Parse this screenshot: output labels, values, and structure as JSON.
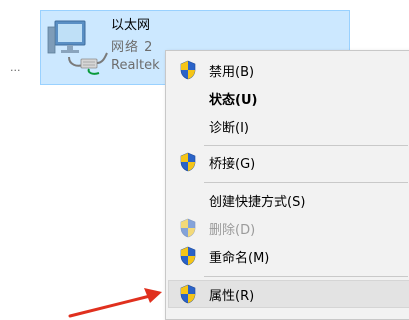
{
  "adapter": {
    "name": "以太网",
    "network": "网络 2",
    "device": "Realtek",
    "icon": "network-adapter-icon"
  },
  "left_text": "...",
  "context_menu": {
    "items": [
      {
        "label": "禁用(B)",
        "shield": true,
        "bold": false,
        "disabled": false
      },
      {
        "label": "状态(U)",
        "shield": false,
        "bold": true,
        "disabled": false
      },
      {
        "label": "诊断(I)",
        "shield": false,
        "bold": false,
        "disabled": false
      },
      {
        "label": "桥接(G)",
        "shield": true,
        "bold": false,
        "disabled": false
      },
      {
        "label": "创建快捷方式(S)",
        "shield": false,
        "bold": false,
        "disabled": false
      },
      {
        "label": "删除(D)",
        "shield": true,
        "bold": false,
        "disabled": true
      },
      {
        "label": "重命名(M)",
        "shield": true,
        "bold": false,
        "disabled": false
      },
      {
        "label": "属性(R)",
        "shield": true,
        "bold": false,
        "disabled": false,
        "highlighted": true
      }
    ]
  },
  "colors": {
    "selection_bg": "#cce8ff",
    "menu_bg": "#f2f2f2",
    "arrow": "#e0301e",
    "shield_blue": "#2b63c8",
    "shield_yellow": "#f5c518"
  }
}
